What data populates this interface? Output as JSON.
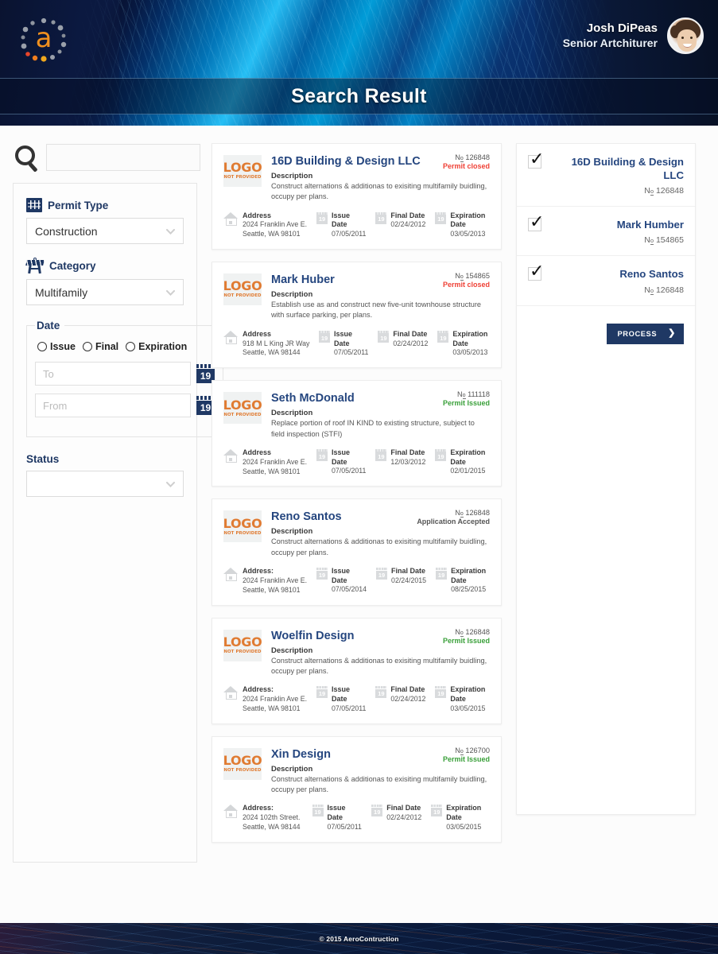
{
  "brand": {
    "logo_letter": "a",
    "accent_color": "#f0901e",
    "primary_color": "#1f3864"
  },
  "header": {
    "user_name": "Josh DiPeas",
    "user_role": "Senior Artchiturer",
    "page_title": "Search Result"
  },
  "sidebar": {
    "search": {
      "value": "",
      "placeholder": ""
    },
    "permit_type": {
      "label": "Permit Type",
      "value": "Construction"
    },
    "category": {
      "label": "Category",
      "value": "Multifamily"
    },
    "date": {
      "legend": "Date",
      "radios": [
        "Issue",
        "Final",
        "Expiration"
      ],
      "to": {
        "value": "",
        "placeholder": "To",
        "icon_day": "19"
      },
      "from": {
        "value": "",
        "placeholder": "From",
        "icon_day": "19"
      }
    },
    "status": {
      "label": "Status",
      "value": ""
    }
  },
  "results": {
    "logo_placeholder": {
      "line1": "LOGO",
      "line2": "NOT PROVIDED"
    },
    "description_label": "Description",
    "cards": [
      {
        "name": "16D Building & Design LLC",
        "number": "126848",
        "status": "Permit closed",
        "status_kind": "closed",
        "description": "Construct alternations & additionas to exisiting multifamily buidling, occupy per plans.",
        "address_label": "Address",
        "address_line1": "2024 Franklin Ave E.",
        "address_line2": "Seattle, WA  98101",
        "issue_label": "Issue Date",
        "issue_date": "07/05/2011",
        "final_label": "Final Date",
        "final_date": "02/24/2012",
        "expiration_label": "Expiration Date",
        "expiration_date": "03/05/2013"
      },
      {
        "name": "Mark Huber",
        "number": "154865",
        "status": "Permit closed",
        "status_kind": "closed",
        "description": "Establish use as and construct new five-unit townhouse structure with surface parking, per plans.",
        "address_label": "Address",
        "address_line1": "918 M L King JR Way",
        "address_line2": "Seattle, WA  98144",
        "issue_label": "Issue Date",
        "issue_date": "07/05/2011",
        "final_label": "Final Date",
        "final_date": "02/24/2012",
        "expiration_label": "Expiration Date",
        "expiration_date": "03/05/2013"
      },
      {
        "name": "Seth McDonald",
        "number": "111118",
        "status": "Permit Issued",
        "status_kind": "issued",
        "description": "Replace portion of roof IN KIND to existing structure, subject to field inspection (STFI)",
        "address_label": "Address",
        "address_line1": "2024 Franklin Ave E.",
        "address_line2": "Seattle, WA  98101",
        "issue_label": "Issue Date",
        "issue_date": "07/05/2011",
        "final_label": "Final Date",
        "final_date": "12/03/2012",
        "expiration_label": "Expiration Date",
        "expiration_date": "02/01/2015"
      },
      {
        "name": "Reno Santos",
        "number": "126848",
        "status": "Application Accepted",
        "status_kind": "accepted",
        "description": "Construct alternations & additionas to exisiting multifamily buidling, occupy per plans.",
        "address_label": "Address:",
        "address_line1": "2024 Franklin Ave E.",
        "address_line2": "Seattle, WA  98101",
        "issue_label": "Issue Date",
        "issue_date": "07/05/2014",
        "final_label": "Final Date",
        "final_date": "02/24/2015",
        "expiration_label": "Expiration Date",
        "expiration_date": "08/25/2015"
      },
      {
        "name": "Woelfin Design",
        "number": "126848",
        "status": "Permit Issued",
        "status_kind": "issued",
        "description": "Construct alternations & additionas to exisiting multifamily buidling, occupy per plans.",
        "address_label": "Address:",
        "address_line1": "2024 Franklin Ave E.",
        "address_line2": "Seattle, WA  98101",
        "issue_label": "Issue Date",
        "issue_date": "07/05/2011",
        "final_label": "Final Date",
        "final_date": "02/24/2012",
        "expiration_label": "Expiration Date",
        "expiration_date": "03/05/2015"
      },
      {
        "name": "Xin Design",
        "number": "126700",
        "status": "Permit Issued",
        "status_kind": "issued",
        "description": "Construct alternations & additionas to exisiting multifamily buidling, occupy per plans.",
        "address_label": "Address:",
        "address_line1": "2024 102th Street.",
        "address_line2": "Seattle, WA  98144",
        "issue_label": "Issue Date",
        "issue_date": "07/05/2011",
        "final_label": "Final Date",
        "final_date": "02/24/2012",
        "expiration_label": "Expiration Date",
        "expiration_date": "03/05/2015"
      }
    ]
  },
  "selection": {
    "items": [
      {
        "name": "16D Building & Design LLC",
        "number": "126848",
        "checked": true
      },
      {
        "name": "Mark Humber",
        "number": "154865",
        "checked": true
      },
      {
        "name": "Reno Santos",
        "number": "126848",
        "checked": true
      }
    ],
    "process_label": "PROCESS",
    "process_arrow": "❯"
  },
  "footer": {
    "copyright": "© 2015 AeroContruction"
  }
}
